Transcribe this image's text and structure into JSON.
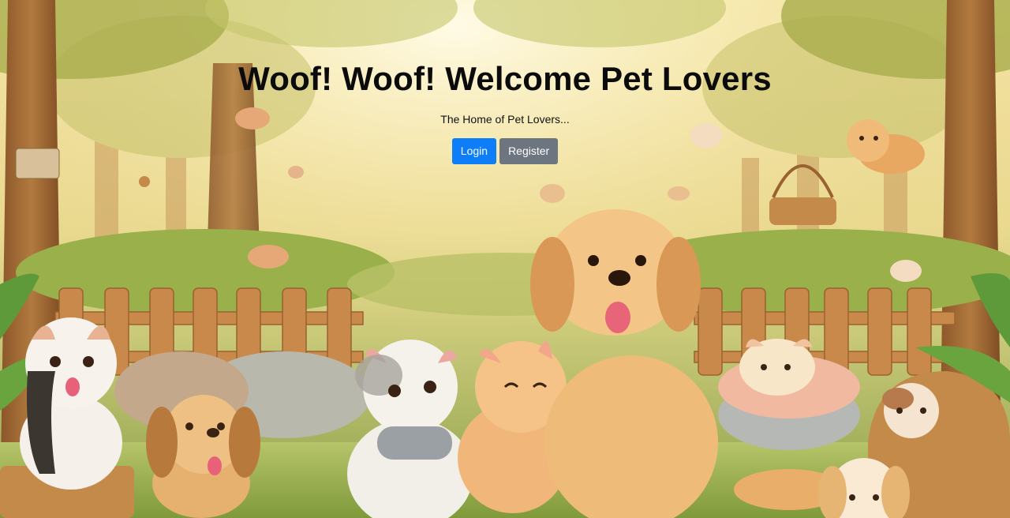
{
  "hero": {
    "title": "Woof! Woof! Welcome Pet Lovers",
    "subtitle": "The Home of Pet Lovers...",
    "login_label": "Login",
    "register_label": "Register"
  },
  "colors": {
    "primary": "#0d7ef8",
    "secondary": "#6d7580"
  }
}
